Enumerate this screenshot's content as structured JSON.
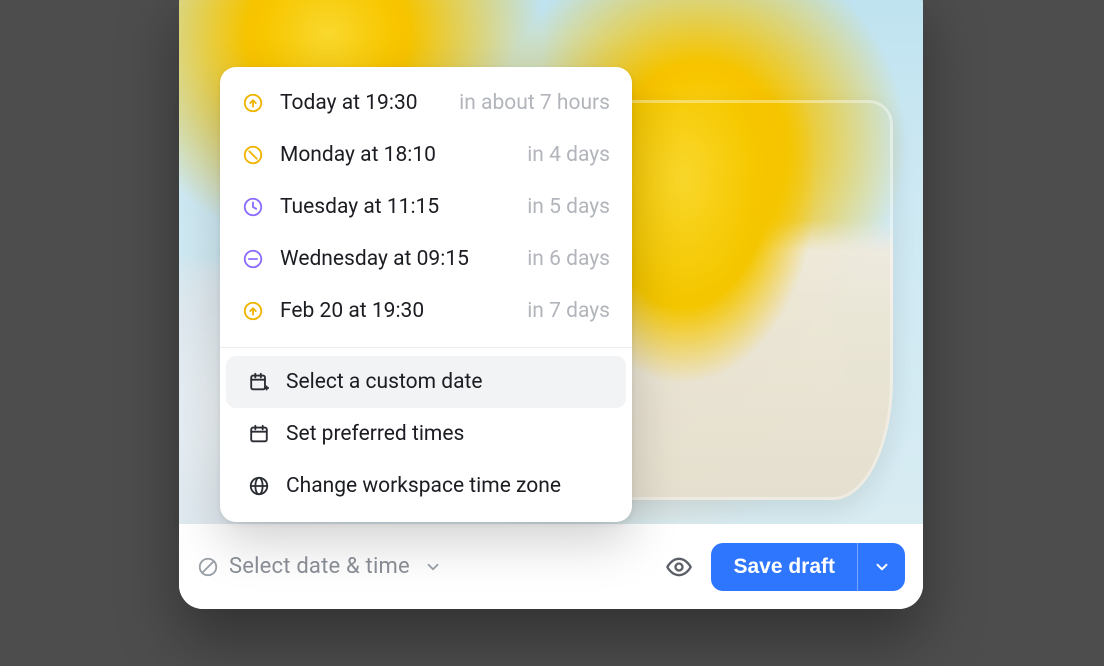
{
  "footer": {
    "select_label": "Select date & time",
    "save_label": "Save draft"
  },
  "popover": {
    "items": [
      {
        "label": "Today at 19:30",
        "hint": "in about 7 hours",
        "icon": "sunrise",
        "icon_color": "#f0b400"
      },
      {
        "label": "Monday at 18:10",
        "hint": "in 4 days",
        "icon": "sunset",
        "icon_color": "#f0b400"
      },
      {
        "label": "Tuesday at 11:15",
        "hint": "in 5 days",
        "icon": "clock",
        "icon_color": "#8c6cff"
      },
      {
        "label": "Wednesday at 09:15",
        "hint": "in 6 days",
        "icon": "minus",
        "icon_color": "#8c6cff"
      },
      {
        "label": "Feb 20 at 19:30",
        "hint": "in 7 days",
        "icon": "sunrise",
        "icon_color": "#f0b400"
      }
    ],
    "actions": {
      "custom_date": "Select a custom date",
      "preferred": "Set preferred times",
      "timezone": "Change workspace time zone"
    }
  }
}
